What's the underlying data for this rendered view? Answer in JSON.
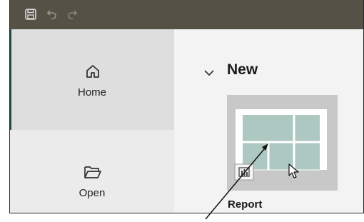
{
  "sidebar": {
    "items": [
      {
        "label": "Home",
        "icon": "home-icon"
      },
      {
        "label": "Open",
        "icon": "folder-open-icon"
      }
    ]
  },
  "titlebar": {
    "icons": [
      "save-icon",
      "undo-icon",
      "redo-icon"
    ]
  },
  "main": {
    "section": {
      "label": "New",
      "expanded": true
    },
    "templates": [
      {
        "label": "Report",
        "icon": "report-icon"
      }
    ]
  },
  "colors": {
    "titlebar": "#555147",
    "sidebar": "#ebebeb",
    "sidebar_selected": "#dedede",
    "accent": "#1f4e3d",
    "tile_bg": "#c8c8c8",
    "report_grid": "#adc8c1"
  }
}
